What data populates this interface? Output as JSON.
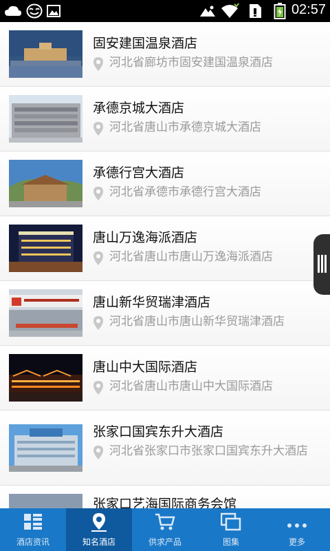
{
  "status_bar": {
    "time": "02:57",
    "icons": [
      "weather-icon",
      "smiley-icon",
      "image-icon",
      "signal-icon",
      "wifi-icon",
      "sim-icon",
      "battery-icon"
    ]
  },
  "hotels": [
    {
      "name": "固安建国温泉酒店",
      "address": "河北省廊坊市固安建国温泉酒店"
    },
    {
      "name": "承德京城大酒店",
      "address": "河北省唐山市承德京城大酒店"
    },
    {
      "name": "承德行宫大酒店",
      "address": "河北省承德市承德行宫大酒店"
    },
    {
      "name": "唐山万逸海派酒店",
      "address": "河北省唐山市唐山万逸海派酒店"
    },
    {
      "name": "唐山新华贸瑞津酒店",
      "address": "河北省唐山市唐山新华贸瑞津酒店"
    },
    {
      "name": "唐山中大国际酒店",
      "address": "河北省唐山市唐山中大国际酒店"
    },
    {
      "name": "张家口国宾东升大酒店",
      "address": "河北省张家口市张家口国宾东升大酒店"
    },
    {
      "name": "张家口艺海国际商务会馆",
      "address": ""
    }
  ],
  "bottom_nav": {
    "active_color": "#0f5a9e",
    "bar_color": "#1a78c8",
    "tabs": [
      {
        "label": "酒店资讯",
        "icon": "grid-list-icon"
      },
      {
        "label": "知名酒店",
        "icon": "map-pin-icon"
      },
      {
        "label": "供求产品",
        "icon": "cart-icon"
      },
      {
        "label": "图集",
        "icon": "gallery-icon"
      },
      {
        "label": "更多",
        "icon": "more-dots-icon"
      }
    ]
  }
}
